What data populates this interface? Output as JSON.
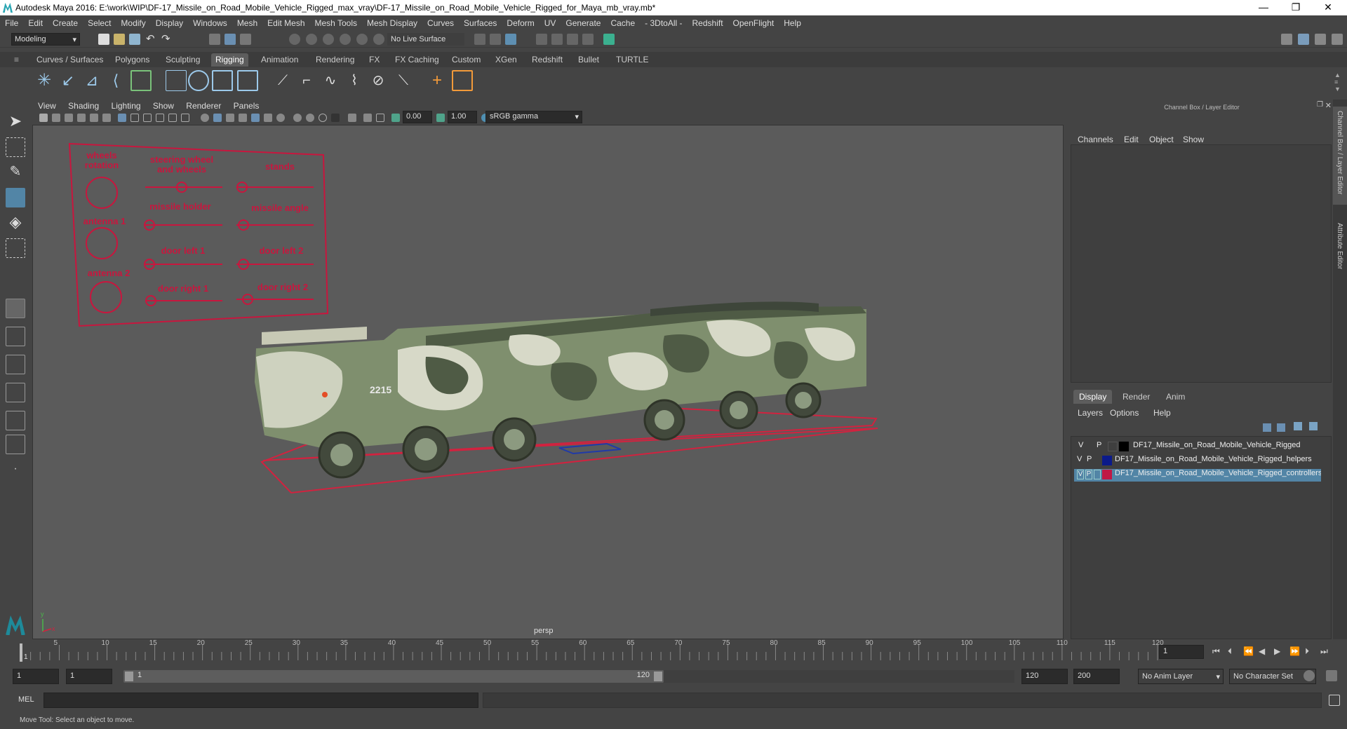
{
  "window": {
    "title": "Autodesk Maya 2016: E:\\work\\WIP\\DF-17_Missile_on_Road_Mobile_Vehicle_Rigged_max_vray\\DF-17_Missile_on_Road_Mobile_Vehicle_Rigged_for_Maya_mb_vray.mb*",
    "minimize": "—",
    "maximize": "❐",
    "close": "✕"
  },
  "menubar": [
    "File",
    "Edit",
    "Create",
    "Select",
    "Modify",
    "Display",
    "Windows",
    "Mesh",
    "Edit Mesh",
    "Mesh Tools",
    "Mesh Display",
    "Curves",
    "Surfaces",
    "Deform",
    "UV",
    "Generate",
    "Cache",
    "- 3DtoAll -",
    "Redshift",
    "OpenFlight",
    "Help"
  ],
  "status": {
    "mode": "Modeling",
    "live_surface": "No Live Surface"
  },
  "shelf_tabs": [
    {
      "label": "Curves / Surfaces"
    },
    {
      "label": "Polygons"
    },
    {
      "label": "Sculpting"
    },
    {
      "label": "Rigging",
      "active": true
    },
    {
      "label": "Animation"
    },
    {
      "label": "Rendering"
    },
    {
      "label": "FX"
    },
    {
      "label": "FX Caching"
    },
    {
      "label": "Custom"
    },
    {
      "label": "XGen"
    },
    {
      "label": "Redshift"
    },
    {
      "label": "Bullet"
    },
    {
      "label": "TURTLE"
    }
  ],
  "viewport": {
    "menu": [
      "View",
      "Shading",
      "Lighting",
      "Show",
      "Renderer",
      "Panels"
    ],
    "exposure": "0.00",
    "gamma": "1.00",
    "color_space": "sRGB gamma",
    "camera_label": "persp",
    "axis_x": "x",
    "axis_y": "y"
  },
  "controls_panel": {
    "labels": {
      "wheels_rotation": "wheels\nrotation",
      "steering": "steering wheel\nand wheels",
      "stands": "stands",
      "missile_holder": "missile holder",
      "missile_angle": "missile angle",
      "antenna1": "antenna 1",
      "antenna2": "antenna 2",
      "door_left1": "door left 1",
      "door_left2": "door left 2",
      "door_right1": "door right 1",
      "door_right2": "door right 2"
    }
  },
  "vehicle": {
    "plate": "2215"
  },
  "channel_box": {
    "title": "Channel Box / Layer Editor",
    "menu": [
      "Channels",
      "Edit",
      "Object",
      "Show"
    ]
  },
  "layer_editor": {
    "tabs": [
      "Display",
      "Render",
      "Anim"
    ],
    "active_tab": "Display",
    "menu": [
      "Layers",
      "Options",
      "Help"
    ],
    "layers": [
      {
        "v": "V",
        "p": "P",
        "color": "#000000",
        "name": "DF17_Missile_on_Road_Mobile_Vehicle_Rigged",
        "selected": false
      },
      {
        "v": "V",
        "p": "P",
        "color": "#0b1a8a",
        "name": "DF17_Missile_on_Road_Mobile_Vehicle_Rigged_helpers",
        "selected": false
      },
      {
        "v": "V",
        "p": "P",
        "color": "#c01845",
        "name": "DF17_Missile_on_Road_Mobile_Vehicle_Rigged_controllers",
        "selected": true
      }
    ]
  },
  "side_tabs": [
    "Channel Box / Layer Editor",
    "Attribute Editor"
  ],
  "timeline": {
    "ticks": [
      "5",
      "10",
      "15",
      "20",
      "25",
      "30",
      "35",
      "40",
      "45",
      "50",
      "55",
      "60",
      "65",
      "70",
      "75",
      "80",
      "85",
      "90",
      "95",
      "100",
      "105",
      "110",
      "115",
      "120"
    ],
    "start_tick": "1",
    "current_frame": "1"
  },
  "range": {
    "start": "1",
    "playback_start": "1",
    "slider_start": "1",
    "slider_end": "120",
    "playback_end": "120",
    "end": "200",
    "anim_layer": "No Anim Layer",
    "character_set": "No Character Set"
  },
  "command_line": {
    "label": "MEL"
  },
  "help_line": "Move Tool: Select an object to move.",
  "colors": {
    "accent": "#5285a6",
    "control_red": "#c8163e",
    "camo_green": "#7f8f6e",
    "camo_dark": "#4f5b45",
    "camo_light": "#d7d9c8",
    "ground_red": "#d2223f"
  }
}
